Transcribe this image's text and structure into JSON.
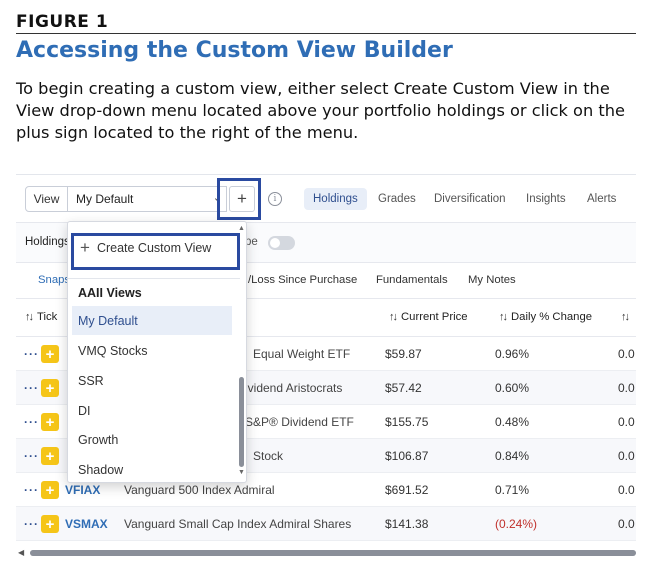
{
  "figure": {
    "label": "FIGURE 1",
    "title": "Accessing the Custom View Builder",
    "description": "To begin creating a custom view, either select Create Custom View in the View drop-down menu located above your portfolio holdings or click on the plus sign located to the right of the menu."
  },
  "toolbar": {
    "view_button": "View",
    "view_selected": "My Default",
    "add_button": "+",
    "info_icon": "i",
    "tabs": [
      "Holdings",
      "Grades",
      "Diversification",
      "Insights",
      "Alerts"
    ],
    "active_tab": "Holdings"
  },
  "filters": {
    "holdings_label": "Holdings",
    "type_label_partial": "pe"
  },
  "subtabs": [
    "Snaps",
    "/Loss Since Purchase",
    "Fundamentals",
    "My Notes"
  ],
  "table": {
    "headers": {
      "ticker": "Tick",
      "current_price": "Current Price",
      "daily_change": "Daily % Change"
    },
    "rows": [
      {
        "ticker": "",
        "name": "Equal Weight ETF",
        "price": "$59.87",
        "change": "0.96%",
        "more": "0.0"
      },
      {
        "ticker": "",
        "name": "ividend Aristocrats",
        "price": "$57.42",
        "change": "0.60%",
        "more": "0.0"
      },
      {
        "ticker": "",
        "name": "S&P® Dividend ETF",
        "price": "$155.75",
        "change": "0.48%",
        "more": "0.0"
      },
      {
        "ticker": "",
        "name": "Stock",
        "price": "$106.87",
        "change": "0.84%",
        "more": "0.0"
      },
      {
        "ticker": "VFIAX",
        "name": "Vanguard 500 Index Admiral",
        "price": "$691.52",
        "change": "0.71%",
        "more": "0.0"
      },
      {
        "ticker": "VSMAX",
        "name": "Vanguard Small Cap Index Admiral Shares",
        "price": "$141.38",
        "change": "(0.24%)",
        "more": "0.0"
      }
    ]
  },
  "dropdown": {
    "create_label": "Create Custom View",
    "section_header": "AAII Views",
    "items": [
      "My Default",
      "VMQ Stocks",
      "SSR",
      "DI",
      "Growth",
      "Shadow"
    ],
    "selected": "My Default"
  },
  "colors": {
    "title_blue": "#2f6db5",
    "highlight_box": "#2a4aa0",
    "add_yellow": "#f5c518",
    "negative_red": "#c0302b"
  }
}
